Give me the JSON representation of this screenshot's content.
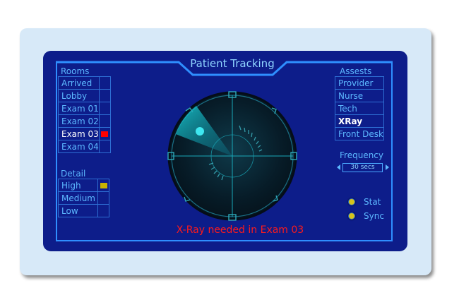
{
  "header": {
    "title": "Patient Tracking"
  },
  "rooms": {
    "label": "Rooms",
    "items": [
      {
        "label": "Arrived",
        "indicator": ""
      },
      {
        "label": "Lobby",
        "indicator": ""
      },
      {
        "label": "Exam 01",
        "indicator": ""
      },
      {
        "label": "Exam 02",
        "indicator": ""
      },
      {
        "label": "Exam 03",
        "indicator": "#ff0000",
        "active": true
      },
      {
        "label": "Exam 04",
        "indicator": ""
      }
    ]
  },
  "detail": {
    "label": "Detail",
    "items": [
      {
        "label": "High",
        "indicator": "#c8b400"
      },
      {
        "label": "Medium",
        "indicator": ""
      },
      {
        "label": "Low",
        "indicator": ""
      }
    ]
  },
  "assets": {
    "label": "Assests",
    "items": [
      {
        "label": "Provider"
      },
      {
        "label": "Nurse"
      },
      {
        "label": "Tech"
      },
      {
        "label": "XRay",
        "active": true
      },
      {
        "label": "Front Desk"
      }
    ]
  },
  "frequency": {
    "label": "Frequency",
    "value": "30 secs"
  },
  "status": {
    "stat_label": "Stat",
    "sync_label": "Sync",
    "dot_color": "#d6c41c"
  },
  "alert": {
    "text": "X-Ray needed in Exam 03",
    "color": "#ff1a1a"
  },
  "colors": {
    "card_bg": "#d7e9f8",
    "panel_bg": "#0d1d8a",
    "accent": "#5cb8ff",
    "radar_glow": "#1ad0d8"
  }
}
